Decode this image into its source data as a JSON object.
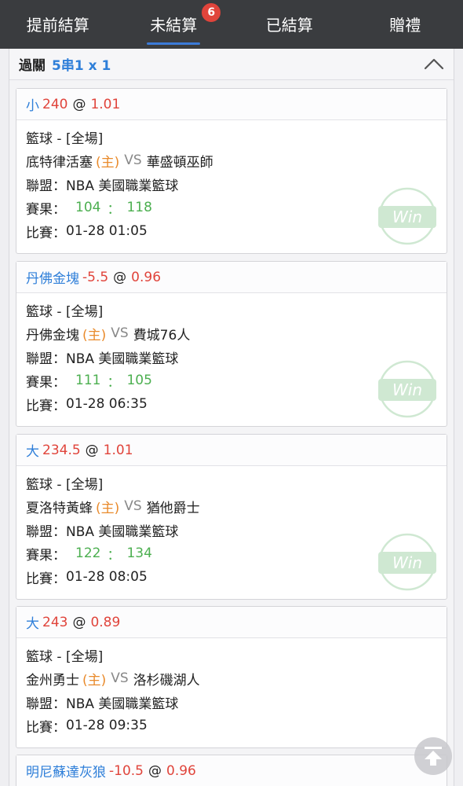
{
  "tabs": [
    {
      "label": "提前結算"
    },
    {
      "label": "未結算",
      "badge": "6"
    },
    {
      "label": "已結算"
    },
    {
      "label": "贈禮"
    }
  ],
  "panel": {
    "title": "過關",
    "type": "5串1 x 1"
  },
  "common": {
    "at": "@",
    "vs": "VS",
    "home": "(主)",
    "sep": "：",
    "win": "Win"
  },
  "bets": [
    {
      "name": "小",
      "handicap": "240",
      "odds": "1.01",
      "sport": "籃球 - [全場]",
      "home_team": "底特律活塞",
      "away_team": "華盛頓巫師",
      "league_label": "聯盟：",
      "league": "NBA 美國職業籃球",
      "result_label": "賽果：",
      "home_score": "104",
      "away_score": "118",
      "time_label": "比賽：",
      "time": "01-28 01:05",
      "status": "Win"
    },
    {
      "name": "丹佛金塊",
      "handicap": "-5.5",
      "odds": "0.96",
      "sport": "籃球 - [全場]",
      "home_team": "丹佛金塊",
      "away_team": "費城76人",
      "league_label": "聯盟：",
      "league": "NBA 美國職業籃球",
      "result_label": "賽果：",
      "home_score": "111",
      "away_score": "105",
      "time_label": "比賽：",
      "time": "01-28 06:35",
      "status": "Win"
    },
    {
      "name": "大",
      "handicap": "234.5",
      "odds": "1.01",
      "sport": "籃球 - [全場]",
      "home_team": "夏洛特黃蜂",
      "away_team": "猶他爵士",
      "league_label": "聯盟：",
      "league": "NBA 美國職業籃球",
      "result_label": "賽果：",
      "home_score": "122",
      "away_score": "134",
      "time_label": "比賽：",
      "time": "01-28 08:05",
      "status": "Win"
    },
    {
      "name": "大",
      "handicap": "243",
      "odds": "0.89",
      "sport": "籃球 - [全場]",
      "home_team": "金州勇士",
      "away_team": "洛杉磯湖人",
      "league_label": "聯盟：",
      "league": "NBA 美國職業籃球",
      "time_label": "比賽：",
      "time": "01-28 09:35"
    },
    {
      "name": "明尼蘇達灰狼",
      "handicap": "-10.5",
      "odds": "0.96"
    }
  ],
  "colors": {
    "tabbar_bg": "#3a3c3f",
    "accent_blue": "#2f7fd9",
    "odds_red": "#e0443b",
    "home_orange": "#e98a2b",
    "score_green": "#4caf50"
  }
}
